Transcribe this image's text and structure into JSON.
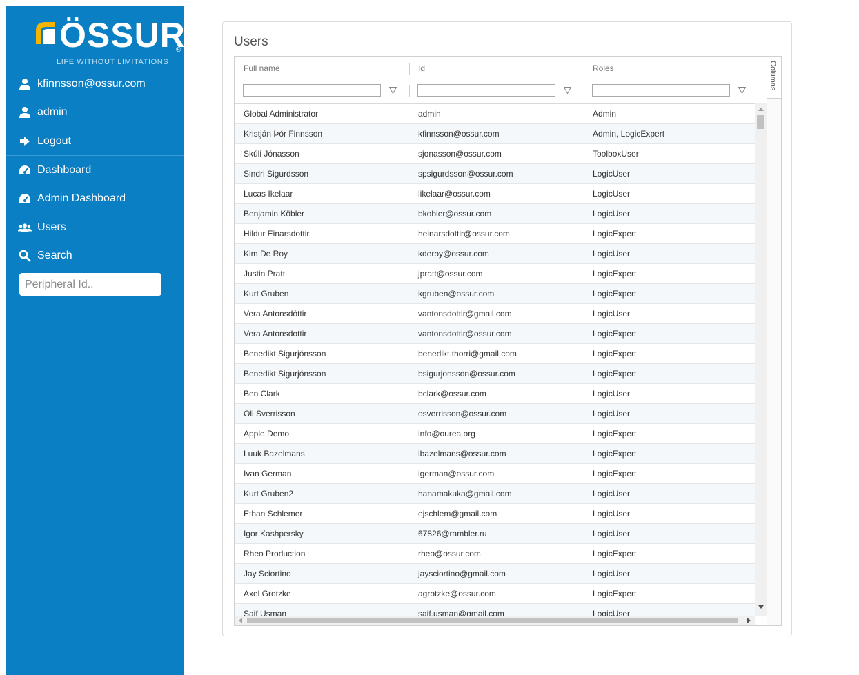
{
  "brand": {
    "name": "ÖSSUR",
    "registered": "®",
    "tagline": "LIFE WITHOUT LIMITATIONS",
    "colors": {
      "sidebar": "#0a7fc3",
      "logo_accent": "#f4b400"
    }
  },
  "sidebar": {
    "user_email": "kfinnsson@ossur.com",
    "user_role": "admin",
    "logout": "Logout",
    "nav": [
      {
        "label": "Dashboard",
        "icon": "tachometer-icon"
      },
      {
        "label": "Admin Dashboard",
        "icon": "tachometer-icon"
      },
      {
        "label": "Users",
        "icon": "users-icon"
      },
      {
        "label": "Search",
        "icon": "search-icon"
      }
    ],
    "peripheral_placeholder": "Peripheral Id.."
  },
  "main": {
    "title": "Users",
    "columns_tab": "Columns",
    "columns": [
      "Full name",
      "Id",
      "Roles"
    ],
    "rows": [
      [
        "Global Administrator",
        "admin",
        "Admin"
      ],
      [
        "Kristján Þór Finnsson",
        "kfinnsson@ossur.com",
        "Admin, LogicExpert"
      ],
      [
        "Skúli Jónasson",
        "sjonasson@ossur.com",
        "ToolboxUser"
      ],
      [
        "Sindri Sigurdsson",
        "spsigurdsson@ossur.com",
        "LogicUser"
      ],
      [
        "Lucas Ikelaar",
        "likelaar@ossur.com",
        "LogicUser"
      ],
      [
        "Benjamin Köbler",
        "bkobler@ossur.com",
        "LogicUser"
      ],
      [
        "Hildur Einarsdottir",
        "heinarsdottir@ossur.com",
        "LogicExpert"
      ],
      [
        "Kim De Roy",
        "kderoy@ossur.com",
        "LogicUser"
      ],
      [
        "Justin Pratt",
        "jpratt@ossur.com",
        "LogicExpert"
      ],
      [
        "Kurt Gruben",
        "kgruben@ossur.com",
        "LogicExpert"
      ],
      [
        "Vera Antonsdóttir",
        "vantonsdottir@gmail.com",
        "LogicUser"
      ],
      [
        "Vera Antonsdottir",
        "vantonsdottir@ossur.com",
        "LogicExpert"
      ],
      [
        "Benedikt Sigurjónsson",
        "benedikt.thorri@gmail.com",
        "LogicExpert"
      ],
      [
        "Benedikt Sigurjónsson",
        "bsigurjonsson@ossur.com",
        "LogicExpert"
      ],
      [
        "Ben Clark",
        "bclark@ossur.com",
        "LogicUser"
      ],
      [
        "Oli Sverrisson",
        "osverrisson@ossur.com",
        "LogicUser"
      ],
      [
        "Apple Demo",
        "info@ourea.org",
        "LogicExpert"
      ],
      [
        "Luuk Bazelmans",
        "lbazelmans@ossur.com",
        "LogicExpert"
      ],
      [
        "Ivan German",
        "igerman@ossur.com",
        "LogicExpert"
      ],
      [
        "Kurt Gruben2",
        "hanamakuka@gmail.com",
        "LogicUser"
      ],
      [
        "Ethan Schlemer",
        "ejschlem@gmail.com",
        "LogicUser"
      ],
      [
        "Igor Kashpersky",
        "67826@rambler.ru",
        "LogicUser"
      ],
      [
        "Rheo Production",
        "rheo@ossur.com",
        "LogicExpert"
      ],
      [
        "Jay Sciortino",
        "jaysciortino@gmail.com",
        "LogicUser"
      ],
      [
        "Axel Grotzke",
        "agrotzke@ossur.com",
        "LogicExpert"
      ],
      [
        "Saif Usman",
        "saif.usman@gmail.com",
        "LogicUser"
      ]
    ]
  }
}
